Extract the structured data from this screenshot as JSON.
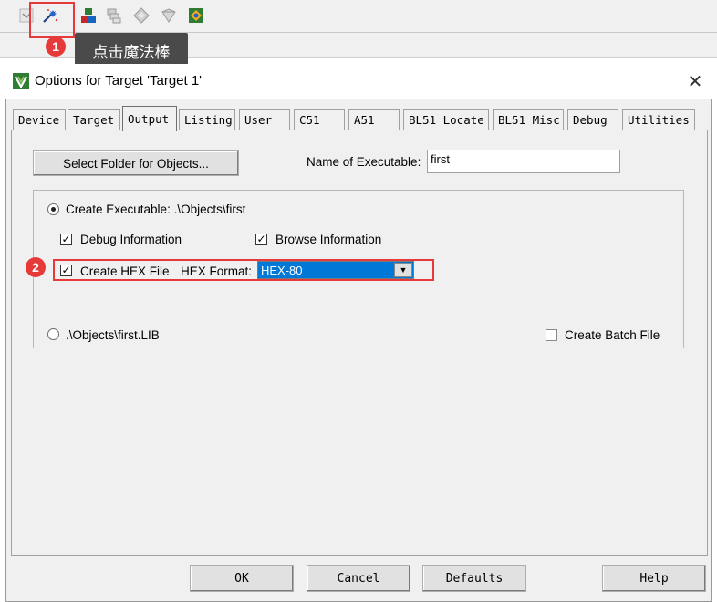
{
  "annotations": {
    "marker_1": "1",
    "marker_2": "2",
    "tooltip_text": "点击魔法棒",
    "accent_color": "#e5393a"
  },
  "toolbar": {
    "icons": [
      "dropdown-arrow-icon",
      "magic-wand-icon",
      "manage-components-icon",
      "select-packs-icon",
      "pack-installer-icon",
      "run-time-environment-icon",
      "translate-icon"
    ]
  },
  "dialog": {
    "title": "Options for Target 'Target 1'",
    "close": "✕",
    "tabs": [
      "Device",
      "Target",
      "Output",
      "Listing",
      "User",
      "C51",
      "A51",
      "BL51 Locate",
      "BL51 Misc",
      "Debug",
      "Utilities"
    ],
    "active_tab": "Output",
    "select_folder_button": "Select Folder for Objects...",
    "name_executable_label": "Name of Executable:",
    "name_executable_value": "first",
    "create_executable_label": "Create Executable:  .\\Objects\\first",
    "debug_info_label": "Debug Information",
    "browse_info_label": "Browse Information",
    "create_hex_label": "Create HEX File",
    "hex_format_label": "HEX Format:",
    "hex_format_value": "HEX-80",
    "create_library_label": ".\\Objects\\first.LIB",
    "create_batch_label": "Create Batch File",
    "checks": {
      "debug_info": true,
      "browse_info": true,
      "create_hex": true,
      "create_batch": false
    },
    "buttons": {
      "ok": "OK",
      "cancel": "Cancel",
      "defaults": "Defaults",
      "help": "Help"
    }
  }
}
